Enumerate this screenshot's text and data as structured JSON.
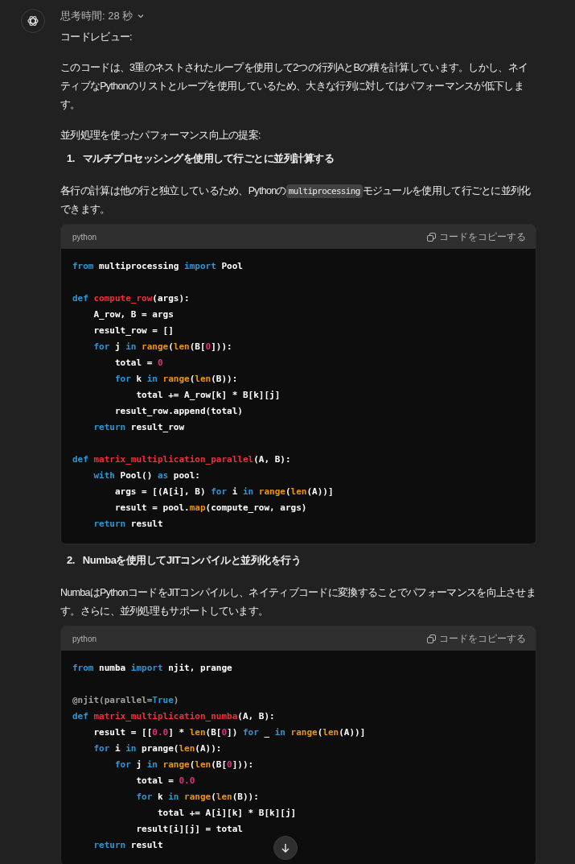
{
  "thinking": {
    "label": "思考時間: 28 秒",
    "expanded": false
  },
  "content": [
    {
      "kind": "paragraph",
      "parts": [
        {
          "kind": "text",
          "text": "コードレビュー:"
        }
      ]
    },
    {
      "kind": "paragraph",
      "parts": [
        {
          "kind": "text",
          "text": "このコードは、3重のネストされたループを使用して2つの行列AとBの積を計算しています。しかし、ネイティブなPythonのリストとループを使用しているため、大きな行列に対してはパフォーマンスが低下します。"
        }
      ]
    },
    {
      "kind": "paragraph",
      "parts": [
        {
          "kind": "text",
          "text": "並列処理を使ったパフォーマンス向上の提案:"
        }
      ]
    },
    {
      "kind": "list_item",
      "number": "1.",
      "text": "マルチプロセッシングを使用して行ごとに並列計算する"
    },
    {
      "kind": "paragraph",
      "parts": [
        {
          "kind": "text",
          "text": "各行の計算は他の行と独立しているため、Pythonの"
        },
        {
          "kind": "code",
          "text": "multiprocessing"
        },
        {
          "kind": "text",
          "text": "モジュールを使用して行ごとに並列化できます。"
        }
      ]
    },
    {
      "kind": "code_block",
      "language": "python",
      "copy_label": "コードをコピーする",
      "lines": [
        {
          "kind": "code",
          "tokens": [
            {
              "kind": "keyword",
              "text": "from"
            },
            {
              "kind": "plain",
              "text": " multiprocessing "
            },
            {
              "kind": "keyword",
              "text": "import"
            },
            {
              "kind": "plain",
              "text": " Pool"
            }
          ]
        },
        {
          "kind": "blank"
        },
        {
          "kind": "code",
          "tokens": [
            {
              "kind": "keyword",
              "text": "def "
            },
            {
              "kind": "function",
              "text": "compute_row"
            },
            {
              "kind": "plain",
              "text": "(args):"
            }
          ]
        },
        {
          "kind": "code",
          "tokens": [
            {
              "kind": "plain",
              "text": "    A_row, B = args"
            }
          ]
        },
        {
          "kind": "code",
          "tokens": [
            {
              "kind": "plain",
              "text": "    result_row = []"
            }
          ]
        },
        {
          "kind": "code",
          "tokens": [
            {
              "kind": "keyword",
              "text": "    for"
            },
            {
              "kind": "plain",
              "text": " j "
            },
            {
              "kind": "keyword",
              "text": "in "
            },
            {
              "kind": "builtin",
              "text": "range"
            },
            {
              "kind": "plain",
              "text": "("
            },
            {
              "kind": "builtin",
              "text": "len"
            },
            {
              "kind": "plain",
              "text": "(B["
            },
            {
              "kind": "number",
              "text": "0"
            },
            {
              "kind": "plain",
              "text": "])):"
            }
          ]
        },
        {
          "kind": "code",
          "tokens": [
            {
              "kind": "plain",
              "text": "        total = "
            },
            {
              "kind": "number",
              "text": "0"
            }
          ]
        },
        {
          "kind": "code",
          "tokens": [
            {
              "kind": "keyword",
              "text": "        for"
            },
            {
              "kind": "plain",
              "text": " k "
            },
            {
              "kind": "keyword",
              "text": "in "
            },
            {
              "kind": "builtin",
              "text": "range"
            },
            {
              "kind": "plain",
              "text": "("
            },
            {
              "kind": "builtin",
              "text": "len"
            },
            {
              "kind": "plain",
              "text": "(B)):"
            }
          ]
        },
        {
          "kind": "code",
          "tokens": [
            {
              "kind": "plain",
              "text": "            total += A_row[k] * B[k][j]"
            }
          ]
        },
        {
          "kind": "code",
          "tokens": [
            {
              "kind": "plain",
              "text": "        result_row.append(total)"
            }
          ]
        },
        {
          "kind": "code",
          "tokens": [
            {
              "kind": "keyword",
              "text": "    return"
            },
            {
              "kind": "plain",
              "text": " result_row"
            }
          ]
        },
        {
          "kind": "blank"
        },
        {
          "kind": "code",
          "tokens": [
            {
              "kind": "keyword",
              "text": "def "
            },
            {
              "kind": "function",
              "text": "matrix_multiplication_parallel"
            },
            {
              "kind": "plain",
              "text": "(A, B):"
            }
          ]
        },
        {
          "kind": "code",
          "tokens": [
            {
              "kind": "keyword",
              "text": "    with"
            },
            {
              "kind": "plain",
              "text": " Pool() "
            },
            {
              "kind": "keyword",
              "text": "as"
            },
            {
              "kind": "plain",
              "text": " pool:"
            }
          ]
        },
        {
          "kind": "code",
          "tokens": [
            {
              "kind": "plain",
              "text": "        args = [(A[i], B) "
            },
            {
              "kind": "keyword",
              "text": "for"
            },
            {
              "kind": "plain",
              "text": " i "
            },
            {
              "kind": "keyword",
              "text": "in "
            },
            {
              "kind": "builtin",
              "text": "range"
            },
            {
              "kind": "plain",
              "text": "("
            },
            {
              "kind": "builtin",
              "text": "len"
            },
            {
              "kind": "plain",
              "text": "(A))]"
            }
          ]
        },
        {
          "kind": "code",
          "tokens": [
            {
              "kind": "plain",
              "text": "        result = pool."
            },
            {
              "kind": "builtin",
              "text": "map"
            },
            {
              "kind": "plain",
              "text": "(compute_row, args)"
            }
          ]
        },
        {
          "kind": "code",
          "tokens": [
            {
              "kind": "keyword",
              "text": "    return"
            },
            {
              "kind": "plain",
              "text": " result"
            }
          ]
        }
      ]
    },
    {
      "kind": "list_item",
      "number": "2.",
      "text": "Numbaを使用してJITコンパイルと並列化を行う"
    },
    {
      "kind": "paragraph",
      "parts": [
        {
          "kind": "text",
          "text": "NumbaはPythonコードをJITコンパイルし、ネイティブコードに変換することでパフォーマンスを向上させます。さらに、並列処理もサポートしています。"
        }
      ]
    },
    {
      "kind": "code_block",
      "language": "python",
      "copy_label": "コードをコピーする",
      "lines": [
        {
          "kind": "code",
          "tokens": [
            {
              "kind": "keyword",
              "text": "from"
            },
            {
              "kind": "plain",
              "text": " numba "
            },
            {
              "kind": "keyword",
              "text": "import"
            },
            {
              "kind": "plain",
              "text": " njit, prange"
            }
          ]
        },
        {
          "kind": "blank"
        },
        {
          "kind": "code",
          "tokens": [
            {
              "kind": "decorator",
              "text": "@njit(parallel="
            },
            {
              "kind": "keyword",
              "text": "True"
            },
            {
              "kind": "decorator",
              "text": ")"
            }
          ]
        },
        {
          "kind": "code",
          "tokens": [
            {
              "kind": "keyword",
              "text": "def "
            },
            {
              "kind": "function",
              "text": "matrix_multiplication_numba"
            },
            {
              "kind": "plain",
              "text": "(A, B):"
            }
          ]
        },
        {
          "kind": "code",
          "tokens": [
            {
              "kind": "plain",
              "text": "    result = [["
            },
            {
              "kind": "number",
              "text": "0.0"
            },
            {
              "kind": "plain",
              "text": "] * "
            },
            {
              "kind": "builtin",
              "text": "len"
            },
            {
              "kind": "plain",
              "text": "(B["
            },
            {
              "kind": "number",
              "text": "0"
            },
            {
              "kind": "plain",
              "text": "]) "
            },
            {
              "kind": "keyword",
              "text": "for"
            },
            {
              "kind": "plain",
              "text": " _ "
            },
            {
              "kind": "keyword",
              "text": "in "
            },
            {
              "kind": "builtin",
              "text": "range"
            },
            {
              "kind": "plain",
              "text": "("
            },
            {
              "kind": "builtin",
              "text": "len"
            },
            {
              "kind": "plain",
              "text": "(A))]"
            }
          ]
        },
        {
          "kind": "code",
          "tokens": [
            {
              "kind": "keyword",
              "text": "    for"
            },
            {
              "kind": "plain",
              "text": " i "
            },
            {
              "kind": "keyword",
              "text": "in"
            },
            {
              "kind": "plain",
              "text": " prange("
            },
            {
              "kind": "builtin",
              "text": "len"
            },
            {
              "kind": "plain",
              "text": "(A)):"
            }
          ]
        },
        {
          "kind": "code",
          "tokens": [
            {
              "kind": "keyword",
              "text": "        for"
            },
            {
              "kind": "plain",
              "text": " j "
            },
            {
              "kind": "keyword",
              "text": "in "
            },
            {
              "kind": "builtin",
              "text": "range"
            },
            {
              "kind": "plain",
              "text": "("
            },
            {
              "kind": "builtin",
              "text": "len"
            },
            {
              "kind": "plain",
              "text": "(B["
            },
            {
              "kind": "number",
              "text": "0"
            },
            {
              "kind": "plain",
              "text": "])):"
            }
          ]
        },
        {
          "kind": "code",
          "tokens": [
            {
              "kind": "plain",
              "text": "            total = "
            },
            {
              "kind": "number",
              "text": "0.0"
            }
          ]
        },
        {
          "kind": "code",
          "tokens": [
            {
              "kind": "keyword",
              "text": "            for"
            },
            {
              "kind": "plain",
              "text": " k "
            },
            {
              "kind": "keyword",
              "text": "in "
            },
            {
              "kind": "builtin",
              "text": "range"
            },
            {
              "kind": "plain",
              "text": "("
            },
            {
              "kind": "builtin",
              "text": "len"
            },
            {
              "kind": "plain",
              "text": "(B)):"
            }
          ]
        },
        {
          "kind": "code",
          "tokens": [
            {
              "kind": "plain",
              "text": "                total += A[i][k] * B[k][j]"
            }
          ]
        },
        {
          "kind": "code",
          "tokens": [
            {
              "kind": "plain",
              "text": "            result[i][j] = total"
            }
          ]
        },
        {
          "kind": "code",
          "tokens": [
            {
              "kind": "keyword",
              "text": "    return"
            },
            {
              "kind": "plain",
              "text": " result"
            }
          ]
        }
      ]
    }
  ]
}
